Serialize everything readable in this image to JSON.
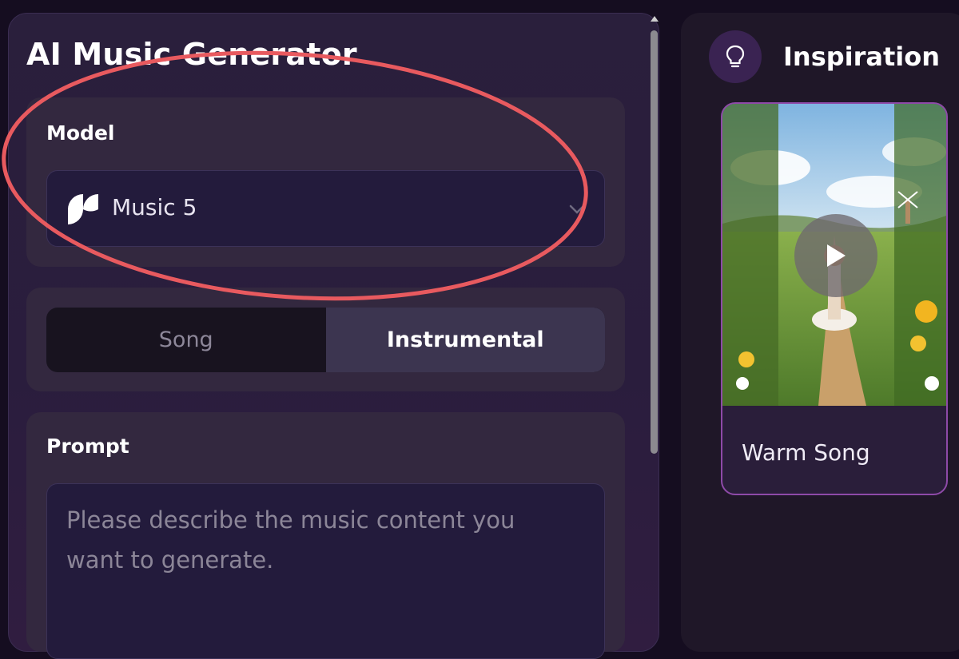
{
  "generator": {
    "title": "AI Music Generator",
    "model_label": "Model",
    "model_value": "Music 5",
    "mode_options": [
      "Song",
      "Instrumental"
    ],
    "selected_mode": "Instrumental",
    "prompt_label": "Prompt",
    "prompt_placeholder": "Please describe the music content you want to generate."
  },
  "inspiration": {
    "title": "Inspiration",
    "cards": [
      {
        "title": "Warm Song"
      }
    ]
  },
  "icons": {
    "model": "wave-logo-icon",
    "dropdown": "chevron-down-icon",
    "inspiration": "lightbulb-icon",
    "play": "play-icon"
  },
  "colors": {
    "background": "#150d20",
    "panel": "#2a1f3c",
    "accent_border": "#8e4aa8",
    "annotation_ellipse": "#e85a5f"
  }
}
